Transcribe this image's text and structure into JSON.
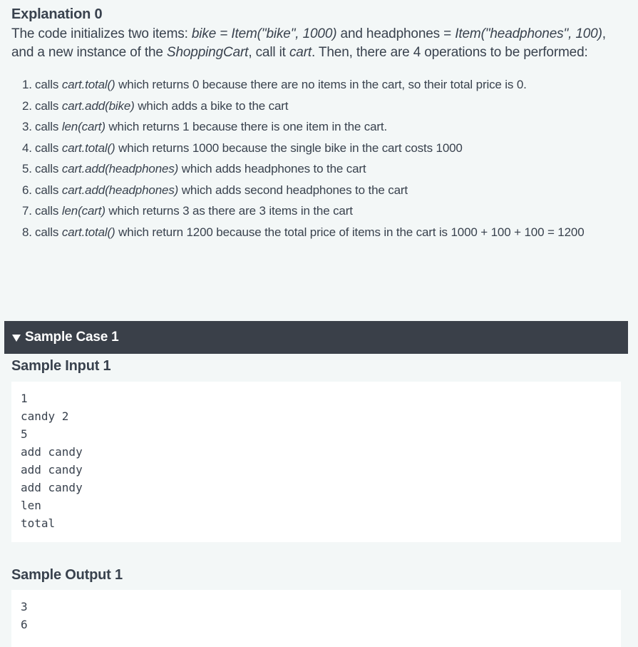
{
  "explanation": {
    "heading": "Explanation 0",
    "intro": [
      {
        "t": "The code initializes two items: "
      },
      {
        "t": "bike = Item(\"bike\", 1000)",
        "i": true
      },
      {
        "t": " and headphones = "
      },
      {
        "t": "Item(\"headphones\", 100)",
        "i": true
      },
      {
        "t": ", and a new instance of the "
      },
      {
        "t": "ShoppingCart",
        "i": true
      },
      {
        "t": ", call it "
      },
      {
        "t": "cart",
        "i": true
      },
      {
        "t": ". Then, there are 4 operations to be performed:"
      }
    ],
    "steps": [
      {
        "num": "1.",
        "parts": [
          {
            "t": "calls "
          },
          {
            "t": "cart.total()",
            "i": true
          },
          {
            "t": " which returns 0 because there are no items in the cart, so their total price is 0."
          }
        ]
      },
      {
        "num": "2.",
        "parts": [
          {
            "t": "calls "
          },
          {
            "t": "cart.add(bike)",
            "i": true
          },
          {
            "t": " which adds a bike to the cart"
          }
        ]
      },
      {
        "num": "3.",
        "parts": [
          {
            "t": "calls "
          },
          {
            "t": "len(cart)",
            "i": true
          },
          {
            "t": " which returns 1 because there is one item in the cart."
          }
        ]
      },
      {
        "num": "4.",
        "parts": [
          {
            "t": "calls "
          },
          {
            "t": "cart.total()",
            "i": true
          },
          {
            "t": " which returns 1000 because the single bike in the cart costs 1000"
          }
        ]
      },
      {
        "num": "5.",
        "parts": [
          {
            "t": "calls "
          },
          {
            "t": "cart.add(headphones)",
            "i": true
          },
          {
            "t": " which adds headphones to the cart"
          }
        ]
      },
      {
        "num": "6.",
        "parts": [
          {
            "t": "calls "
          },
          {
            "t": "cart.add(headphones)",
            "i": true
          },
          {
            "t": " which adds second headphones to the cart"
          }
        ]
      },
      {
        "num": "7.",
        "parts": [
          {
            "t": "calls "
          },
          {
            "t": "len(cart)",
            "i": true
          },
          {
            "t": " which returns 3 as there are 3 items in the cart"
          }
        ]
      },
      {
        "num": "8.",
        "parts": [
          {
            "t": "calls "
          },
          {
            "t": "cart.total()",
            "i": true
          },
          {
            "t": " which return 1200 because the total price of items in the cart is 1000 + 100 + 100 = 1200"
          }
        ]
      }
    ]
  },
  "sample_case": {
    "title": "Sample Case 1",
    "expanded": true,
    "input_heading": "Sample Input 1",
    "input_lines": [
      "1",
      "candy 2",
      "5",
      "add candy",
      "add candy",
      "add candy",
      "len",
      "total"
    ],
    "output_heading": "Sample Output 1",
    "output_lines": [
      "3",
      "6"
    ]
  },
  "colors": {
    "page_bg": "#f3f7f7",
    "text": "#39424e",
    "case_bar_bg": "#3a4049",
    "code_bg": "#ffffff"
  },
  "icons": {
    "case_toggle": "triangle-down-icon"
  }
}
